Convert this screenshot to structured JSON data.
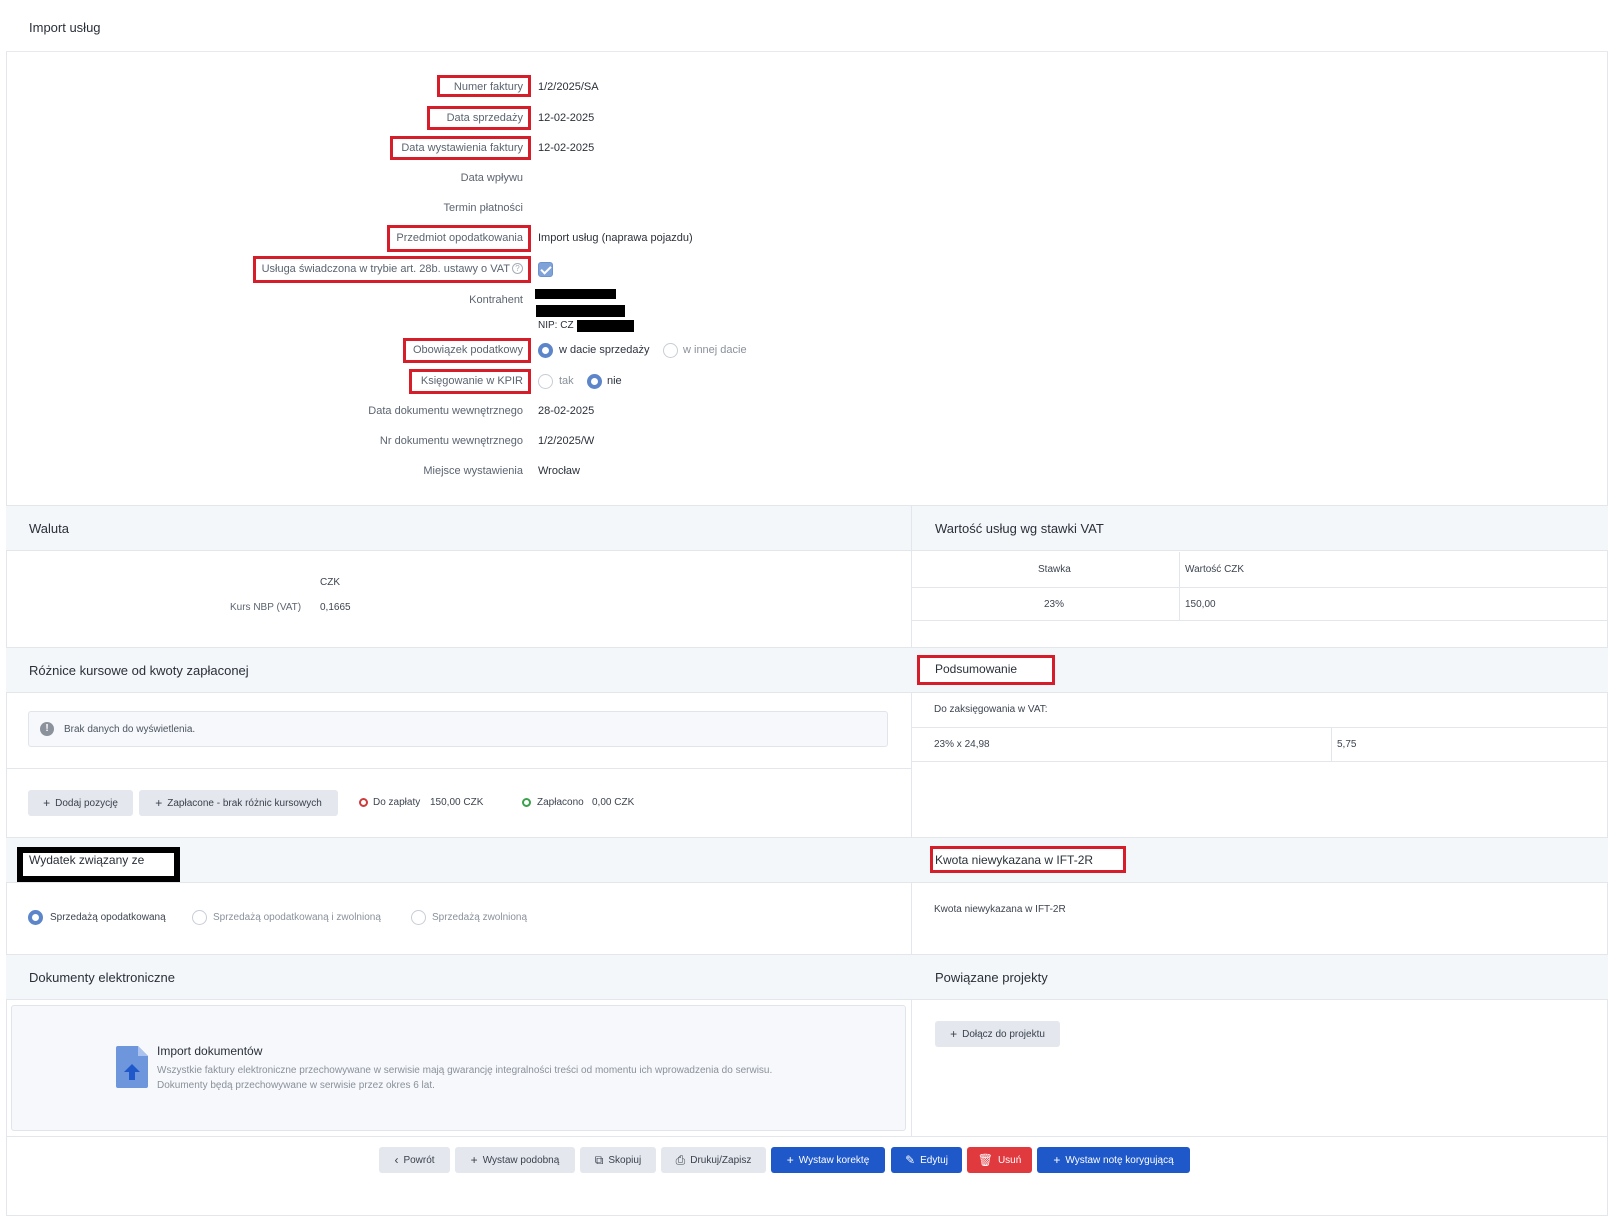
{
  "header": {
    "title": "Import usług"
  },
  "details": {
    "invoice_number": {
      "label": "Numer faktury",
      "value": "1/2/2025/SA"
    },
    "sale_date": {
      "label": "Data sprzedaży",
      "value": "12-02-2025"
    },
    "issue_date": {
      "label": "Data wystawienia faktury",
      "value": "12-02-2025"
    },
    "receipt_date": {
      "label": "Data wpływu",
      "value": ""
    },
    "payment_term": {
      "label": "Termin płatności",
      "value": ""
    },
    "taxation_subject": {
      "label": "Przedmiot opodatkowania",
      "value": "Import usług (naprawa pojazdu)"
    },
    "service_art28b": {
      "label": "Usługa świadczona w trybie art. 28b. ustawy o VAT",
      "checked": true
    },
    "contractor": {
      "label": "Kontrahent",
      "nip_prefix": "NIP: CZ"
    },
    "tax_obligation": {
      "label": "Obowiązek podatkowy",
      "options": [
        "w dacie sprzedaży",
        "w innej dacie"
      ],
      "selected": "w dacie sprzedaży"
    },
    "kpir": {
      "label": "Księgowanie w KPIR",
      "options": [
        "tak",
        "nie"
      ],
      "selected": "nie"
    },
    "internal_doc_date": {
      "label": "Data dokumentu wewnętrznego",
      "value": "28-02-2025"
    },
    "internal_doc_number": {
      "label": "Nr dokumentu wewnętrznego",
      "value": "1/2/2025/W"
    },
    "issue_place": {
      "label": "Miejsce wystawienia",
      "value": "Wrocław"
    }
  },
  "currency": {
    "title": "Waluta",
    "code": "CZK",
    "rate_label": "Kurs NBP (VAT)",
    "rate_value": "0,1665"
  },
  "vat_values": {
    "title": "Wartość usług wg stawki VAT",
    "columns": [
      "Stawka",
      "Wartość CZK"
    ],
    "rows": [
      {
        "rate": "23%",
        "value": "150,00"
      }
    ]
  },
  "exchange_diff": {
    "title": "Różnice kursowe od kwoty zapłaconej",
    "empty_message": "Brak danych do wyświetlenia.",
    "add_button": "Dodaj pozycję",
    "paid_no_diff_button": "Zapłacone - brak różnic kursowych",
    "to_pay_label": "Do zapłaty",
    "to_pay_value": "150,00 CZK",
    "paid_label": "Zapłacono",
    "paid_value": "0,00 CZK"
  },
  "summary": {
    "title": "Podsumowanie",
    "subheader": "Do zaksięgowania w VAT:",
    "row_label": "23% x 24,98",
    "row_value": "5,75"
  },
  "expense": {
    "title": "Wydatek związany ze",
    "options": [
      "Sprzedażą opodatkowaną",
      "Sprzedażą opodatkowaną i zwolnioną",
      "Sprzedażą zwolnioną"
    ],
    "selected": "Sprzedażą opodatkowaną"
  },
  "unreported": {
    "title": "Kwota niewykazana w IFT-2R",
    "label": "Kwota niewykazana w IFT-2R"
  },
  "edocs": {
    "title": "Dokumenty elektroniczne",
    "import_title": "Import dokumentów",
    "import_text_1": "Wszystkie faktury elektroniczne przechowywane w serwisie mają gwarancję integralności treści od momentu ich wprowadzenia do serwisu.",
    "import_text_2": "Dokumenty będą przechowywane w serwisie przez okres 6 lat."
  },
  "projects": {
    "title": "Powiązane projekty",
    "join_button": "Dołącz do projektu"
  },
  "toolbar": {
    "back": "Powrót",
    "issue_similar": "Wystaw podobną",
    "copy": "Skopiuj",
    "print_save": "Drukuj/Zapisz",
    "issue_correction": "Wystaw korektę",
    "edit": "Edytuj",
    "delete": "Usuń",
    "issue_correction_note": "Wystaw notę korygującą"
  },
  "colors": {
    "primary_blue": "#1f58c9",
    "danger_red": "#e0393e",
    "highlight_red": "#d61e2b",
    "section_bg": "#f4f7fa"
  }
}
